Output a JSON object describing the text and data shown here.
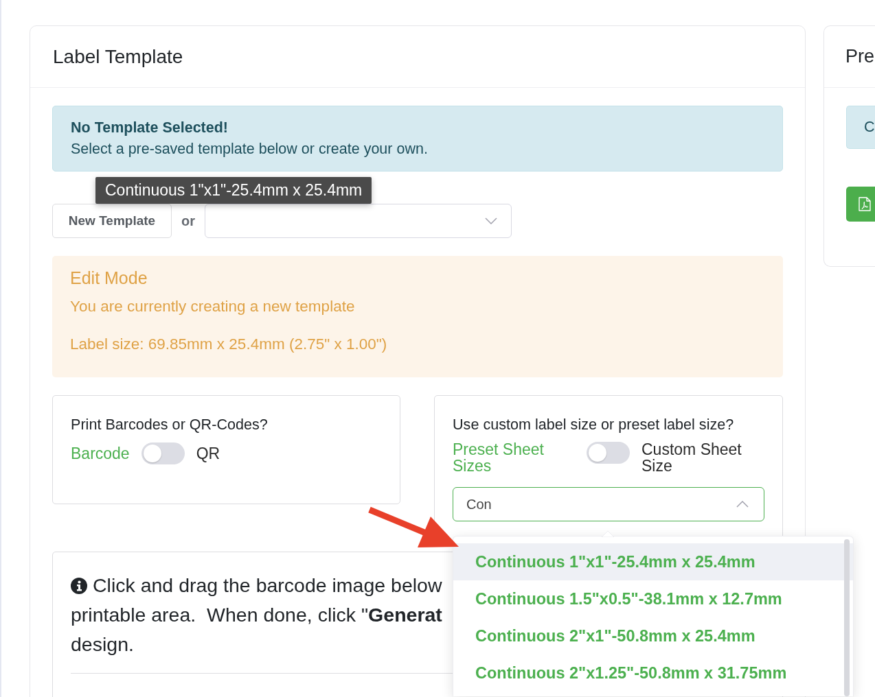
{
  "label_template": {
    "title": "Label Template",
    "notice": {
      "heading": "No Template Selected!",
      "text": "Select a pre-saved template below or create your own."
    },
    "tooltip": "Continuous 1\"x1\"-25.4mm x 25.4mm",
    "new_template_button": "New Template",
    "or_label": "or",
    "template_select": {
      "expanded": false
    },
    "edit_mode": {
      "heading": "Edit Mode",
      "lines": [
        "You are currently creating a new template",
        "Label size: 69.85mm x 25.4mm (2.75\" x 1.00\")"
      ]
    },
    "code_type": {
      "question": "Print Barcodes or QR-Codes?",
      "off_label": "Barcode",
      "on_label": "QR",
      "on": false
    },
    "size_mode": {
      "question": "Use custom label size or preset label size?",
      "off_label": "Preset Sheet Sizes",
      "on_label": "Custom Sheet Size",
      "on": false,
      "size_select": {
        "value": "Con",
        "expanded": true,
        "options": [
          {
            "label": "Continuous 1\"x1\"-25.4mm x 25.4mm",
            "selected": true
          },
          {
            "label": "Continuous 1.5\"x0.5\"-38.1mm x 12.7mm",
            "selected": false
          },
          {
            "label": "Continuous 2\"x1\"-50.8mm x 25.4mm",
            "selected": false
          },
          {
            "label": "Continuous 2\"x1.25\"-50.8mm x 31.75mm",
            "selected": false
          }
        ]
      }
    },
    "instructions": {
      "lines": [
        "Click and drag the barcode image below",
        "printable area.  When done, click \"**Generat**",
        "design."
      ]
    }
  },
  "preview": {
    "title": "Pre",
    "notice": "C"
  }
}
